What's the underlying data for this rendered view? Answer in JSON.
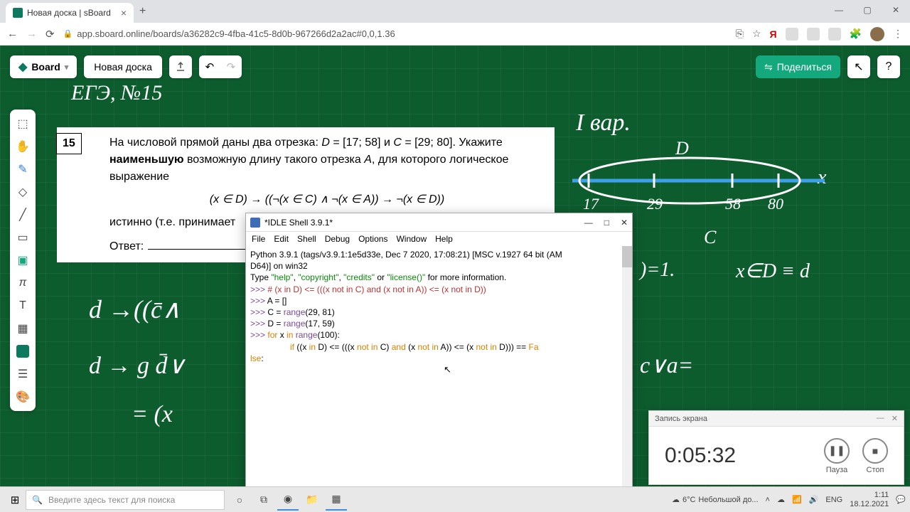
{
  "browser": {
    "tab_title": "Новая доска | sBoard",
    "url": "app.sboard.online/boards/a36282c9-4fba-41c5-8d0b-967266d2a2ac#0,0,1.36"
  },
  "board": {
    "logo": "Board",
    "name": "Новая доска",
    "share": "Поделиться"
  },
  "handwriting": {
    "title": "ЕГЭ, №15",
    "var": "I вар.",
    "d_label": "D",
    "c_label": "C",
    "x_label": "x",
    "n17": "17",
    "n29": "29",
    "n58": "58",
    "n80": "80",
    "eq1": ")=1.",
    "eq2": "x∈D ≡ d",
    "line1": "d →((c̄∧",
    "line2": "d → g    d̄∨",
    "line3": "= (x",
    "line4": "c∨a="
  },
  "problem": {
    "num": "15",
    "p1a": "На числовой прямой даны два отрезка: ",
    "p1b": "D",
    "p1c": " = [17; 58] и ",
    "p1d": "C",
    "p1e": " = [29; 80]. Укажите ",
    "p2a": "наименьшую",
    "p2b": " возможную длину такого отрезка ",
    "p2c": "A",
    "p2d": ", для которого логическое выражение",
    "formula": "(x ∈ D) → ((¬(x ∈ C) ∧ ¬(x ∈ A)) → ¬(x ∈ D))",
    "p3": "истинно (т.е. принимает",
    "ans": "Ответ:"
  },
  "idle": {
    "title": "*IDLE Shell 3.9.1*",
    "menu": [
      "File",
      "Edit",
      "Shell",
      "Debug",
      "Options",
      "Window",
      "Help"
    ],
    "l1": "Python 3.9.1 (tags/v3.9.1:1e5d33e, Dec  7 2020, 17:08:21) [MSC v.1927 64 bit (AM",
    "l2": "D64)] on win32",
    "l3a": "Type ",
    "l3b": "\"help\"",
    "l3c": ", ",
    "l3d": "\"copyright\"",
    "l3e": ", ",
    "l3f": "\"credits\"",
    "l3g": " or ",
    "l3h": "\"license()\"",
    "l3i": " for more information.",
    "l4": "# (x in D) <= (((x not in C) and (x not in A)) <= (x not in D))",
    "l5": "A = []",
    "l6a": "C = ",
    "l6b": "range",
    "l6c": "(29, 81)",
    "l7a": "D = ",
    "l7b": "range",
    "l7c": "(17, 59)",
    "l8a": "for",
    "l8b": " x ",
    "l8c": "in",
    "l8d": " ",
    "l8e": "range",
    "l8f": "(100):",
    "l9a": "if",
    "l9b": " ((x ",
    "l9c": "in",
    "l9d": " D) <= (((x ",
    "l9e": "not in",
    "l9f": " C) ",
    "l9g": "and",
    "l9h": " (x ",
    "l9i": "not in",
    "l9j": " A)) <= (x ",
    "l9k": "not in",
    "l9l": " D))) == ",
    "l9m": "Fa",
    "l10a": "lse",
    "l10b": ":",
    "prompt": ">>> "
  },
  "recorder": {
    "title": "Запись экрана",
    "time": "0:05:32",
    "pause": "Пауза",
    "stop": "Стоп"
  },
  "taskbar": {
    "search_placeholder": "Введите здесь текст для поиска",
    "weather_temp": "6°C",
    "weather_desc": "Небольшой до...",
    "lang": "ENG",
    "time": "1:11",
    "date": "18.12.2021"
  }
}
